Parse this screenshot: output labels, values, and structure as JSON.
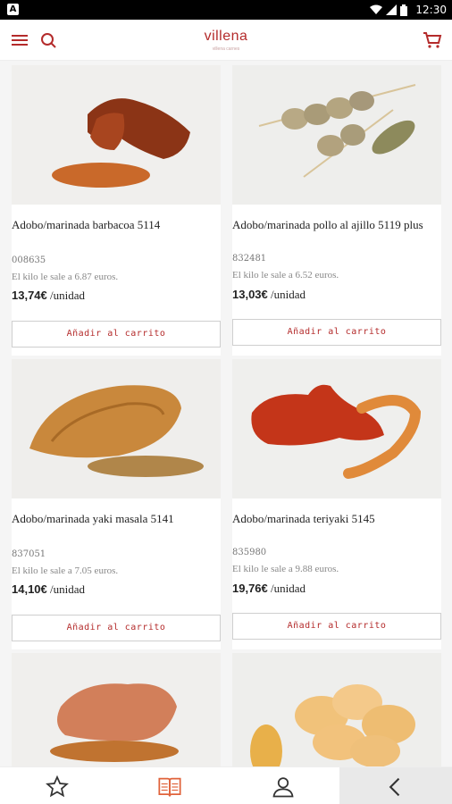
{
  "status_bar": {
    "time": "12:30",
    "notification_letter": "A"
  },
  "app_bar": {
    "logo": "villena",
    "logo_sub": "villena carnes"
  },
  "products": [
    {
      "name": "Adobo/marinada barbacoa 5114",
      "code": "008635",
      "price_per_kilo": "El kilo le sale a 6.87 euros.",
      "price": "13,74€",
      "unit": "/unidad",
      "button": "Añadir al carrito"
    },
    {
      "name": "Adobo/marinada pollo al ajillo 5119 plus",
      "code": "832481",
      "price_per_kilo": "El kilo le sale a 6.52 euros.",
      "price": "13,03€",
      "unit": "/unidad",
      "button": "Añadir al carrito"
    },
    {
      "name": "Adobo/marinada yaki masala 5141",
      "code": "837051",
      "price_per_kilo": "El kilo le sale a 7.05 euros.",
      "price": "14,10€",
      "unit": "/unidad",
      "button": "Añadir al carrito"
    },
    {
      "name": "Adobo/marinada teriyaki 5145",
      "code": "835980",
      "price_per_kilo": "El kilo le sale a 9.88 euros.",
      "price": "19,76€",
      "unit": "/unidad",
      "button": "Añadir al carrito"
    }
  ],
  "colors": {
    "accent": "#b42b2b",
    "active_tab": "#e0623a"
  },
  "bottom_nav": [
    "star-icon",
    "catalog-book-icon",
    "user-icon",
    "back-chevron-icon"
  ]
}
